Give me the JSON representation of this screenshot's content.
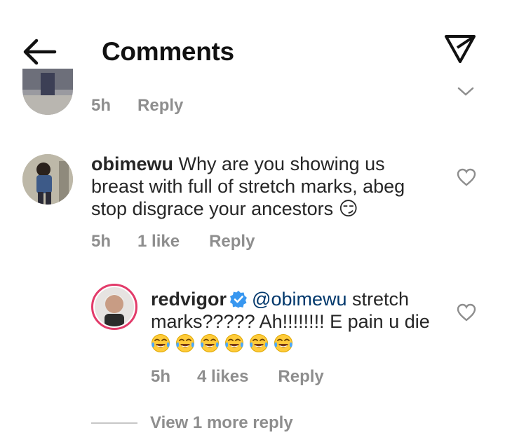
{
  "header": {
    "title": "Comments"
  },
  "comments": [
    {
      "time": "5h",
      "reply_label": "Reply"
    },
    {
      "username": "obimewu",
      "text": " Why are you showing us breast with full of stretch marks, abeg stop disgrace your ancestors 😏",
      "time": "5h",
      "likes": "1 like",
      "reply_label": "Reply"
    }
  ],
  "reply": {
    "username": "redvigor",
    "mention": "@obimewu",
    "text": " stretch marks????? Ah!!!!!!!! E pain u die ",
    "emoji_count": 6,
    "time": "5h",
    "likes": "4 likes",
    "reply_label": "Reply"
  },
  "view_more": "View 1 more reply",
  "colors": {
    "text": "#262626",
    "meta": "#8e8e8e",
    "mention": "#00376b",
    "verified": "#3897f0"
  }
}
